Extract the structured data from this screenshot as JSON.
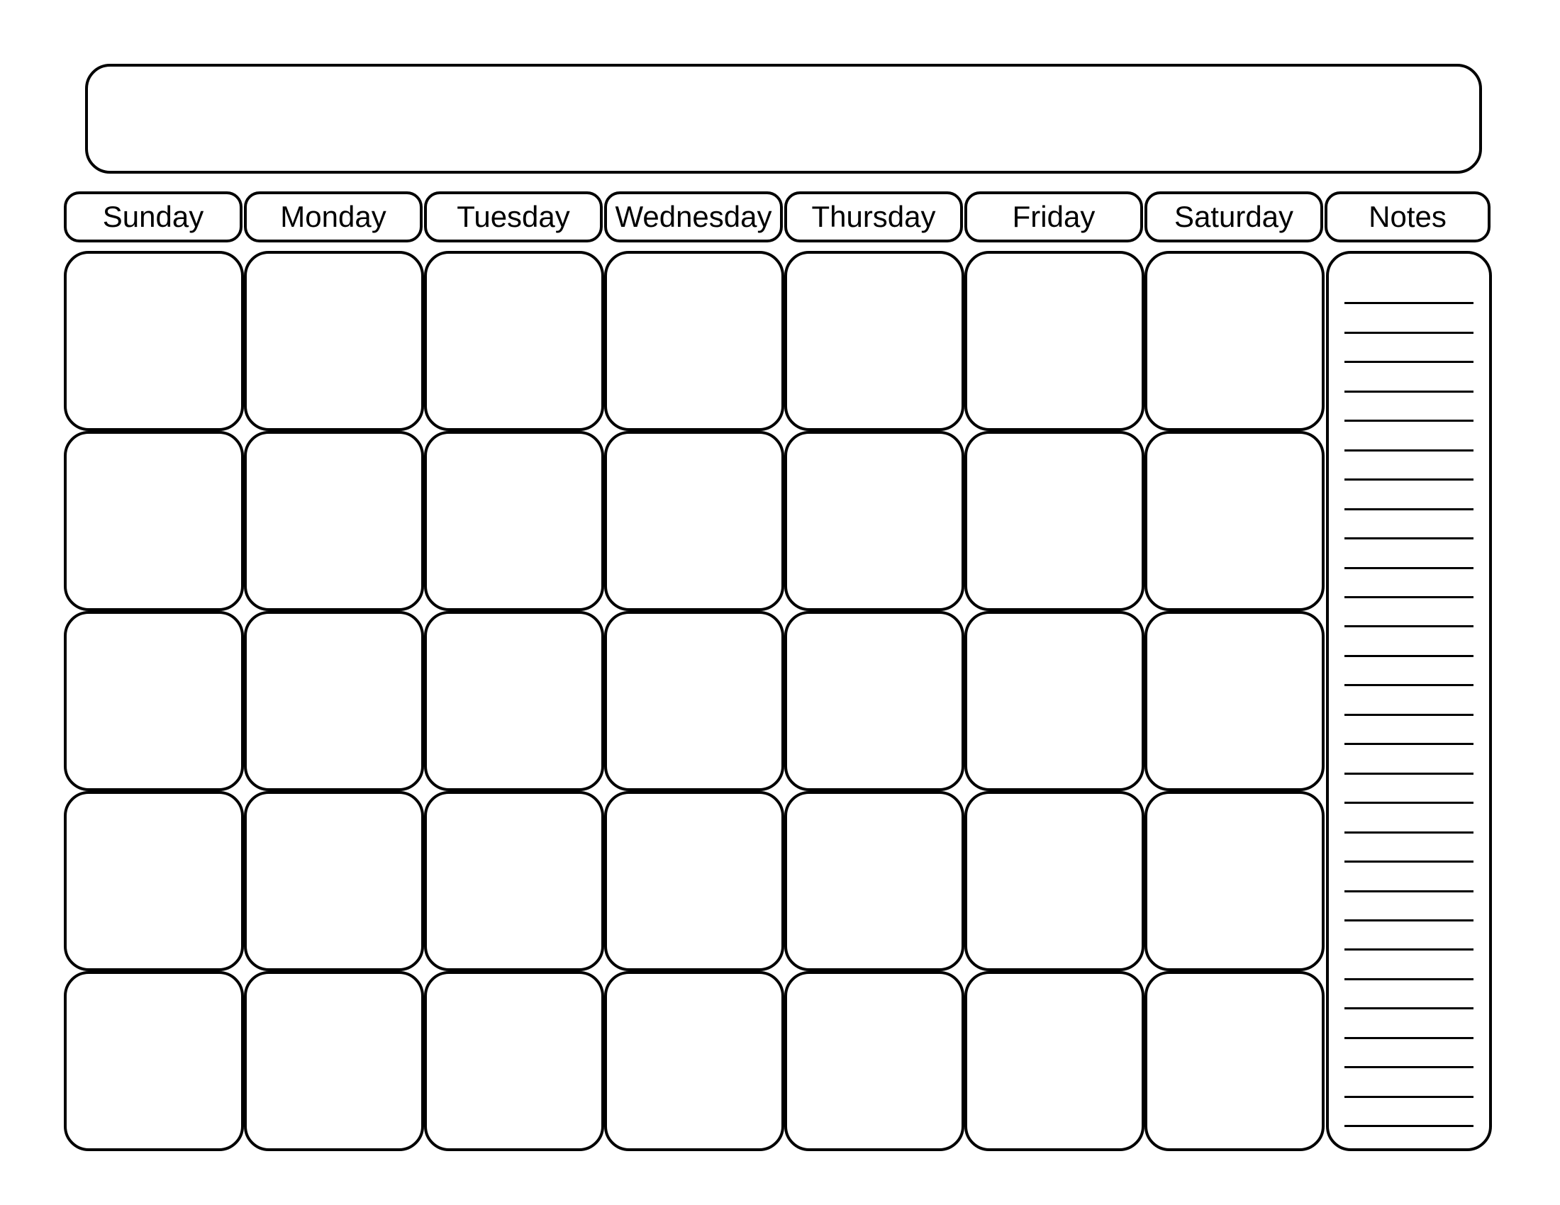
{
  "title": "",
  "headers": {
    "sunday": "Sunday",
    "monday": "Monday",
    "tuesday": "Tuesday",
    "wednesday": "Wednesday",
    "thursday": "Thursday",
    "friday": "Friday",
    "saturday": "Saturday",
    "notes": "Notes"
  },
  "grid": {
    "rows": 5,
    "cols": 7
  },
  "notes_lines": 29
}
